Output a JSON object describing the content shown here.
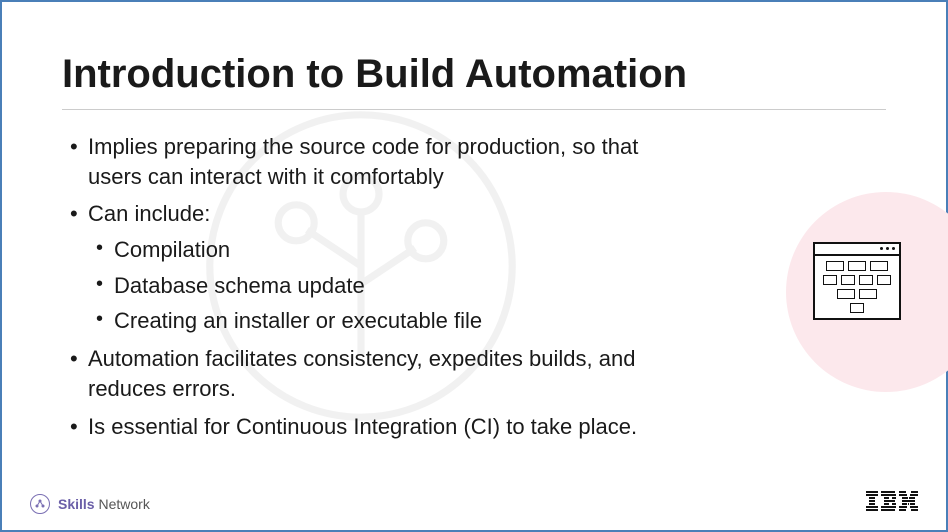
{
  "title": "Introduction to Build Automation",
  "bullets": {
    "b1": "Implies preparing the source code for production, so that users can interact with it comfortably",
    "b2": "Can include:",
    "sub": {
      "s1": "Compilation",
      "s2": "Database schema update",
      "s3": "Creating an installer or executable file"
    },
    "b3": "Automation facilitates consistency, expedites builds, and reduces errors.",
    "b4": "Is essential for Continuous Integration (CI) to take place."
  },
  "footer": {
    "skills_bold": "Skills",
    "skills_light": "Network",
    "ibm": "IBM"
  }
}
